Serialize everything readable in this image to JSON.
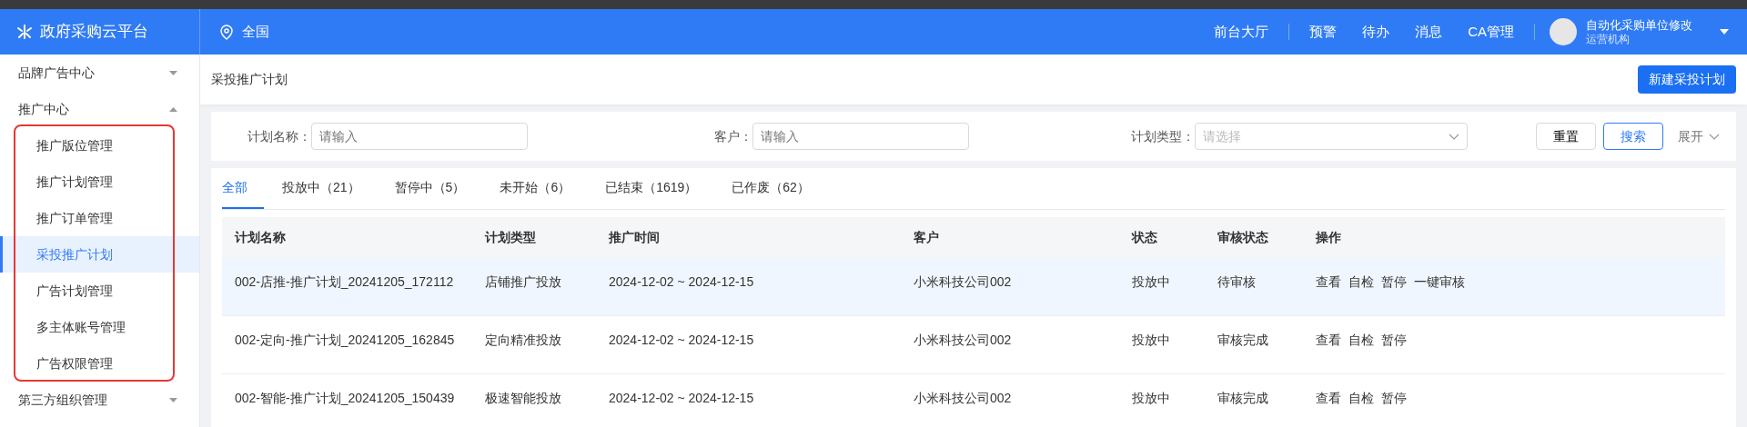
{
  "header": {
    "logo": "政府采购云平台",
    "region": "全国",
    "nav": [
      "前台大厅",
      "预警",
      "待办",
      "消息",
      "CA管理"
    ],
    "user": {
      "name": "自动化采购单位修改",
      "role": "运营机构"
    }
  },
  "sidebar": {
    "items": [
      {
        "label": "品牌广告中心",
        "expanded": false
      },
      {
        "label": "推广中心",
        "expanded": true,
        "children": [
          {
            "label": "推广版位管理",
            "selected": false
          },
          {
            "label": "推广计划管理",
            "selected": false
          },
          {
            "label": "推广订单管理",
            "selected": false
          },
          {
            "label": "采投推广计划",
            "selected": true
          },
          {
            "label": "广告计划管理",
            "selected": false
          },
          {
            "label": "多主体账号管理",
            "selected": false
          },
          {
            "label": "广告权限管理",
            "selected": false
          }
        ]
      },
      {
        "label": "第三方组织管理",
        "expanded": false
      }
    ]
  },
  "page": {
    "title": "采投推广计划",
    "primary_button": "新建采投计划"
  },
  "filters": {
    "fields": [
      {
        "kind": "input",
        "label": "计划名称：",
        "placeholder": "请输入"
      },
      {
        "kind": "input",
        "label": "客户：",
        "placeholder": "请输入"
      },
      {
        "kind": "select",
        "label": "计划类型：",
        "placeholder": "请选择"
      }
    ],
    "reset": "重置",
    "search": "搜索",
    "expand": "展开"
  },
  "tabs": [
    {
      "label": "全部",
      "selected": true
    },
    {
      "label": "投放中（21）",
      "selected": false
    },
    {
      "label": "暂停中（5）",
      "selected": false
    },
    {
      "label": "未开始（6）",
      "selected": false
    },
    {
      "label": "已结束（1619）",
      "selected": false
    },
    {
      "label": "已作废（62）",
      "selected": false
    }
  ],
  "table": {
    "columns": [
      "计划名称",
      "计划类型",
      "推广时间",
      "客户",
      "状态",
      "审核状态",
      "操作"
    ],
    "rows": [
      {
        "selected": true,
        "cells": [
          "002-店推-推广计划_20241205_172112",
          "店铺推广投放",
          "2024-12-02 ~ 2024-12-15",
          "小米科技公司002",
          "投放中",
          "待审核"
        ],
        "actions": [
          "查看",
          "自检",
          "暂停",
          "一键审核"
        ]
      },
      {
        "selected": false,
        "cells": [
          "002-定向-推广计划_20241205_162845",
          "定向精准投放",
          "2024-12-02 ~ 2024-12-15",
          "小米科技公司002",
          "投放中",
          "审核完成"
        ],
        "actions": [
          "查看",
          "自检",
          "暂停"
        ]
      },
      {
        "selected": false,
        "cells": [
          "002-智能-推广计划_20241205_150439",
          "极速智能投放",
          "2024-12-02 ~ 2024-12-15",
          "小米科技公司002",
          "投放中",
          "审核完成"
        ],
        "actions": [
          "查看",
          "自检",
          "暂停"
        ]
      }
    ]
  }
}
